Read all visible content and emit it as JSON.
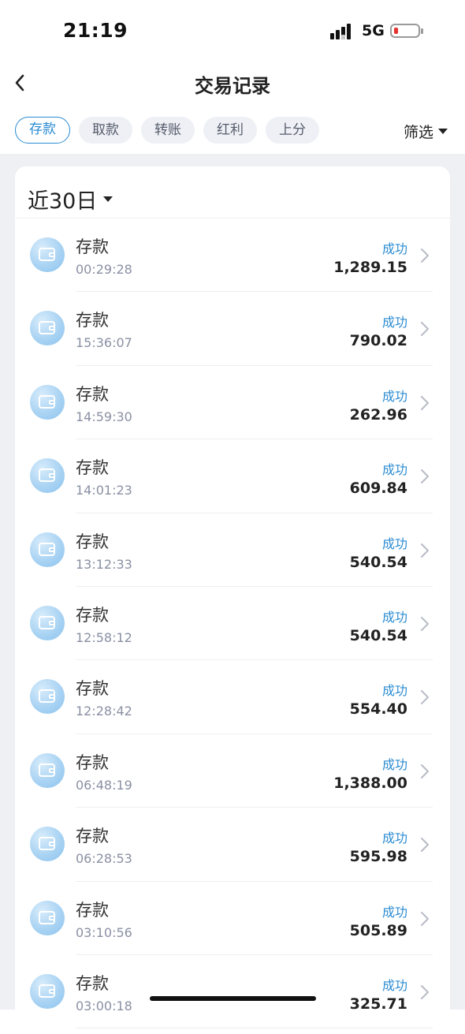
{
  "status_bar": {
    "time": "21:19",
    "network": "5G"
  },
  "header": {
    "title": "交易记录"
  },
  "tabs": [
    {
      "label": "存款",
      "active": true
    },
    {
      "label": "取款",
      "active": false
    },
    {
      "label": "转账",
      "active": false
    },
    {
      "label": "红利",
      "active": false
    },
    {
      "label": "上分",
      "active": false
    }
  ],
  "filter": {
    "label": "筛选"
  },
  "range": {
    "label": "近30日"
  },
  "transactions": [
    {
      "type": "存款",
      "time": "00:29:28",
      "status": "成功",
      "amount": "1,289.15"
    },
    {
      "type": "存款",
      "time": "15:36:07",
      "status": "成功",
      "amount": "790.02"
    },
    {
      "type": "存款",
      "time": "14:59:30",
      "status": "成功",
      "amount": "262.96"
    },
    {
      "type": "存款",
      "time": "14:01:23",
      "status": "成功",
      "amount": "609.84"
    },
    {
      "type": "存款",
      "time": "13:12:33",
      "status": "成功",
      "amount": "540.54"
    },
    {
      "type": "存款",
      "time": "12:58:12",
      "status": "成功",
      "amount": "540.54"
    },
    {
      "type": "存款",
      "time": "12:28:42",
      "status": "成功",
      "amount": "554.40"
    },
    {
      "type": "存款",
      "time": "06:48:19",
      "status": "成功",
      "amount": "1,388.00"
    },
    {
      "type": "存款",
      "time": "06:28:53",
      "status": "成功",
      "amount": "595.98"
    },
    {
      "type": "存款",
      "time": "03:10:56",
      "status": "成功",
      "amount": "505.89"
    },
    {
      "type": "存款",
      "time": "03:00:18",
      "status": "成功",
      "amount": "325.71"
    }
  ],
  "colors": {
    "accent": "#2a8bd2",
    "background": "#eff0f4",
    "battery_low": "#e5312f"
  },
  "icons": {
    "back": "chevron-left-icon",
    "row": "wallet-icon",
    "row_arrow": "chevron-right-icon"
  }
}
